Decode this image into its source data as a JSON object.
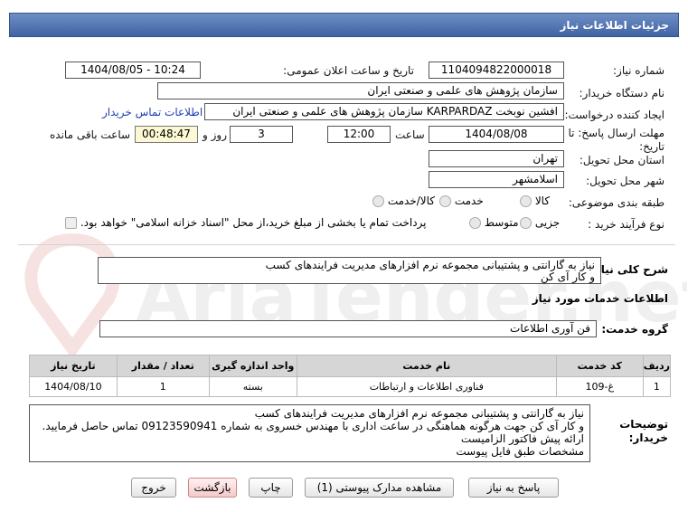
{
  "header": {
    "title": "جزئیات اطلاعات نیاز"
  },
  "fields": {
    "need_number_label": "شماره نیاز:",
    "need_number": "1104094822000018",
    "announce_label": "تاریخ و ساعت اعلان عمومی:",
    "announce_value": "1404/08/05 - 10:24",
    "buyer_label": "نام دستگاه خریدار:",
    "buyer_value": "سازمان پژوهش های علمی و صنعتی ایران",
    "creator_label": "ایجاد کننده درخواست:",
    "creator_value": "افشین نوبخت KARPARDAZ سازمان پژوهش های علمی و صنعتی ایران",
    "contact_link": "اطلاعات تماس خریدار",
    "deadline_label_1": "مهلت ارسال پاسخ: تا",
    "deadline_label_2": "تاریخ:",
    "deadline_date": "1404/08/08",
    "time_label": "ساعت",
    "deadline_time": "12:00",
    "days_value": "3",
    "days_label": "روز و",
    "remaining_time": "00:48:47",
    "remaining_label": "ساعت باقی مانده",
    "province_label": "استان محل تحویل:",
    "province_value": "تهران",
    "city_label": "شهر محل تحویل:",
    "city_value": "اسلامشهر",
    "category_label": "طبقه بندی موضوعی:",
    "category_options": [
      "کالا",
      "خدمت",
      "کالا/خدمت"
    ],
    "process_label": "نوع فرآیند خرید :",
    "process_options": [
      "جزیی",
      "متوسط"
    ],
    "payment_note": "پرداخت تمام یا بخشی از مبلغ خرید،از محل \"اسناد خزانه اسلامی\" خواهد بود."
  },
  "summary": {
    "label": "شرح کلی نیاز:",
    "line1": "نیاز به گارانتی و پشتیبانی مجموعه نرم افزارهای مدیریت فرایندهای کسب",
    "line2": "و کار آی کن"
  },
  "services": {
    "section_title": "اطلاعات خدمات مورد نیاز",
    "group_label": "گروه خدمت:",
    "group_value": "فن آوری اطلاعات",
    "columns": [
      "ردیف",
      "کد خدمت",
      "نام خدمت",
      "واحد اندازه گیری",
      "تعداد / مقدار",
      "تاریخ نیاز"
    ],
    "rows": [
      [
        "1",
        "غ-109",
        "فناوری اطلاعات و ارتباطات",
        "بسته",
        "1",
        "1404/08/10"
      ]
    ]
  },
  "buyer_notes": {
    "label_1": "توضیحات",
    "label_2": "خریدار:",
    "line1": "نیاز به گارانتی و پشتیبانی مجموعه نرم افزارهای مدیریت فرایندهای کسب",
    "line2": "و کار آی کن جهت هرگونه هماهنگی در ساعت اداری با مهندس خسروی به شماره 09123590941 تماس حاصل فرمایید.",
    "line3": "ارائه پیش فاکتور الزامیست",
    "line4": "مشخصات طبق فایل پیوست"
  },
  "buttons": {
    "reply": "پاسخ به نیاز",
    "attachments": "مشاهده مدارک پیوستی (1)",
    "print": "چاپ",
    "back": "بازگشت",
    "exit": "خروج"
  },
  "colors": {
    "header": "#4a6cae",
    "link": "#1e3fb5",
    "remaining_bg": "#fbf8d3"
  }
}
